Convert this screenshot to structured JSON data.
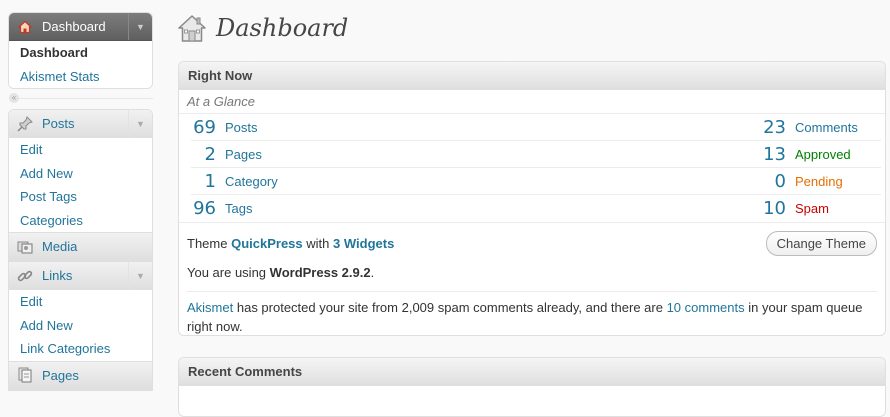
{
  "sidebar": {
    "dashboard": {
      "label": "Dashboard",
      "items": [
        {
          "label": "Dashboard",
          "active": true
        },
        {
          "label": "Akismet Stats"
        }
      ]
    },
    "posts": {
      "label": "Posts",
      "items": [
        "Edit",
        "Add New",
        "Post Tags",
        "Categories"
      ]
    },
    "media": {
      "label": "Media"
    },
    "links": {
      "label": "Links",
      "items": [
        "Edit",
        "Add New",
        "Link Categories"
      ]
    },
    "pages": {
      "label": "Pages"
    },
    "icons": {
      "dashboard": "home-icon",
      "posts": "pushpin-icon",
      "media": "media-icon",
      "links": "chain-link-icon",
      "pages": "pages-icon"
    }
  },
  "header": {
    "title": "Dashboard",
    "icon": "home-icon"
  },
  "right_now": {
    "title": "Right Now",
    "subtitle": "At a Glance",
    "content": [
      {
        "count": "69",
        "label": "Posts"
      },
      {
        "count": "2",
        "label": "Pages"
      },
      {
        "count": "1",
        "label": "Category"
      },
      {
        "count": "96",
        "label": "Tags"
      }
    ],
    "discussion": [
      {
        "count": "23",
        "label": "Comments",
        "color": "#21759b"
      },
      {
        "count": "13",
        "label": "Approved",
        "color": "#008000"
      },
      {
        "count": "0",
        "label": "Pending",
        "color": "#e66f00"
      },
      {
        "count": "10",
        "label": "Spam",
        "color": "#cc0000"
      }
    ],
    "theme": {
      "prefix": "Theme",
      "name": "QuickPress",
      "with": "with",
      "widgets": "3 Widgets"
    },
    "change_theme_label": "Change Theme",
    "version": {
      "prefix": "You are using",
      "name": "WordPress 2.9.2",
      "suffix": "."
    },
    "akismet": {
      "link": "Akismet",
      "text1": "has protected your site from 2,009 spam comments already, and there are",
      "link2": "10 comments",
      "text2": "in your spam queue right now."
    }
  },
  "recent_comments": {
    "title": "Recent Comments"
  }
}
